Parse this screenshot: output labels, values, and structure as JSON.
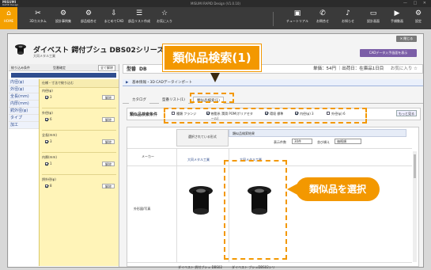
{
  "app": {
    "brand": "MISUMI",
    "brand_sub": "RAPID Design",
    "window_title": "MISUMI RAPID Design (V1.0.10)",
    "window_controls": "— □ ✕"
  },
  "toolbar": {
    "items": [
      {
        "label": "HOME",
        "icon": "home-icon"
      },
      {
        "label": "3Dカスタム",
        "icon": "tools-icon"
      },
      {
        "label": "設計事例集",
        "icon": "cart-icon"
      },
      {
        "label": "部品組合せ",
        "icon": "parts-icon"
      },
      {
        "label": "まとめてCAD",
        "icon": "download-icon"
      },
      {
        "label": "部品リスト作成",
        "icon": "list-icon"
      },
      {
        "label": "お気に入り",
        "icon": "star-icon"
      },
      {
        "label": "チュートリアル",
        "icon": "tutorial-icon"
      },
      {
        "label": "お問合せ",
        "icon": "phone-icon"
      },
      {
        "label": "お知らせ",
        "icon": "bell-icon"
      },
      {
        "label": "設計画面",
        "icon": "screen-icon"
      },
      {
        "label": "手順動画",
        "icon": "video-icon"
      },
      {
        "label": "設定",
        "icon": "gear-icon"
      }
    ]
  },
  "dialog": {
    "close_label": "✕ 閉じる",
    "product_name": "ダイベスト 鍔付ブシュ DBS02シリーズ",
    "maker": "大同メタル工業",
    "cad_button": "CADデータ入手画面を表示",
    "spec_key": "型番",
    "spec_value": "DB",
    "spec_info": "単価：54円 ｜出荷日：在庫品1日目",
    "favorite_label": "お気に入り ☆",
    "basic_info": "基本情報・3D CADデータインポート",
    "tabs": [
      "カタログ",
      "型番リスト(1)",
      "類似品検索(1)"
    ],
    "active_tab": 2
  },
  "left_panel": {
    "header_a": "絞り込み条件",
    "header_b": "型番確定",
    "header_c": "全て解除",
    "items": [
      "内径(φ)",
      "外径(φ)",
      "全長(mm)",
      "内厚(mm)",
      "鍔外径(φ)",
      "タイプ",
      "加工"
    ],
    "sub_header": "仕様・寸法で絞り込む",
    "filters": [
      {
        "label": "内径(φ)",
        "value": "3",
        "clear": "解除"
      },
      {
        "label": "外径(φ)",
        "value": "6",
        "clear": "解除"
      },
      {
        "label": "全長(mm)",
        "value": "3",
        "clear": "解除"
      },
      {
        "label": "内厚(mm)",
        "value": "1",
        "clear": "解除"
      },
      {
        "label": "鍔外径(φ)",
        "value": "8",
        "clear": "解除"
      }
    ]
  },
  "conditions": {
    "title": "類似品検索条件",
    "items": [
      {
        "label": "種類 フランジ",
        "checked": false
      },
      {
        "label": "樹脂系 潤滑 POM(ポリアセタール)",
        "checked": true
      },
      {
        "label": "環境 標準",
        "checked": true
      },
      {
        "label": "内径(φ) 3",
        "checked": true
      },
      {
        "label": "外径(φ) 6",
        "checked": false
      }
    ],
    "more_button": "もっと見る",
    "note": "※類似品検索条件の指定により中間の値を..."
  },
  "results": {
    "left_title": "選択されている形式",
    "right_title": "類似品検索結果",
    "display_count_label": "表示件数",
    "display_count_value": "30件",
    "sort_label": "並び順え",
    "sort_value": "価格順",
    "maker_label": "メーカー",
    "shape_label": "外形図/写真",
    "left_maker": "大同メタル工業",
    "right_maker": "大同メタル工業",
    "left_name": "ダイベスト 鍔付ブシュ DBS02",
    "right_name": "ダイベスト ブシュDBS02シリ"
  },
  "callouts": {
    "main": "類似品検索(1)",
    "select": "類似品を選択"
  },
  "colors": {
    "accent_orange": "#f39800",
    "nav_blue": "#2f4d8f",
    "filter_yellow": "#fff4b8",
    "cad_purple": "#7b5ea7"
  }
}
